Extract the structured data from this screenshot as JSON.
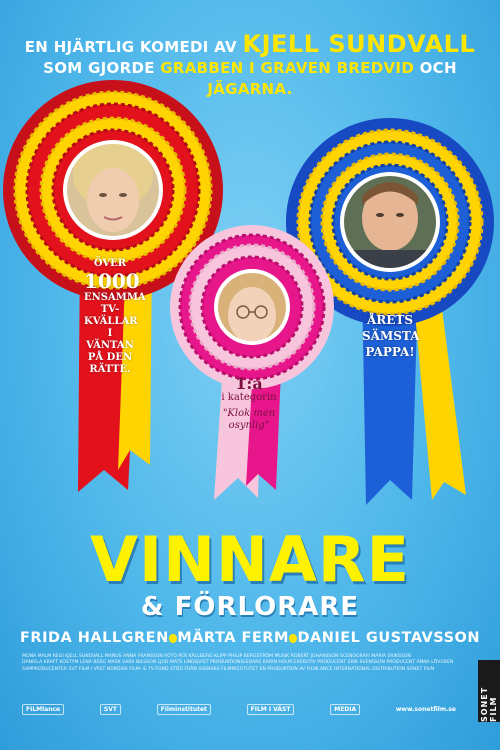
{
  "tagline": {
    "line1_prefix": "EN HJÄRTLIG KOMEDI AV",
    "director": "KJELL SUNDVALL",
    "line2_prefix": "SOM GJORDE",
    "film1": "GRABBEN I GRAVEN BREDVID",
    "line2_mid": "OCH",
    "film2": "JÄGARNA."
  },
  "ribbons": {
    "red": {
      "l1": "ÖVER",
      "num": "1000",
      "l2": "ENSAMMA",
      "l3": "TV-KVÄLLAR",
      "l4": "I VÄNTAN",
      "l5": "PÅ DEN",
      "l6": "RÄTTE."
    },
    "pink": {
      "rank": "1:a",
      "l1": "i kategorin",
      "q": "\"Klok men osynlig\""
    },
    "blue": {
      "l1": "ÅRETS",
      "l2": "SÄMSTA",
      "l3": "PAPPA!"
    }
  },
  "title": {
    "main": "VINNARE",
    "sub": "& FÖRLORARE"
  },
  "cast": [
    "FRIDA HALLGREN",
    "MÄRTA FERM",
    "DANIEL GUSTAVSSON"
  ],
  "credits": [
    "MONA MALM  REGI KJELL SUNDVALL  MANUS ANNA FRANSSON  FOTO PER KÄLLBERG  KLIPP PHILIP BERGSTRÖM  MUSIK ROBERT JOHANSSON  SCENOGRAFI MARIA ERIKSSON",
    "DANIELA KRAFT  KOSTYM LENA BERG  MASK SARA NILSSON  LJUD MATS LINDQVIST  PRODUKTIONSLEDARE KARIN HOLM  EXEKUTIV PRODUCENT ERIK SVENSSON  PRODUCENT ANNA LÖVGREN",
    "SAMPRODUCENTER SVT  FILM I VÄST  NORDISK FILM- & TV-FOND  STÖD FRÅN SVENSKA FILMINSTITUTET  EN PRODUKTION AV FILMLANCE INTERNATIONAL  DISTRIBUTION SONET FILM"
  ],
  "logos": [
    "FILMlance",
    "SVT",
    "Filminstitutet",
    "FILM I VÄST",
    "MEDIA",
    "www.sonetfilm.se"
  ],
  "distributor": "SONET FILM"
}
